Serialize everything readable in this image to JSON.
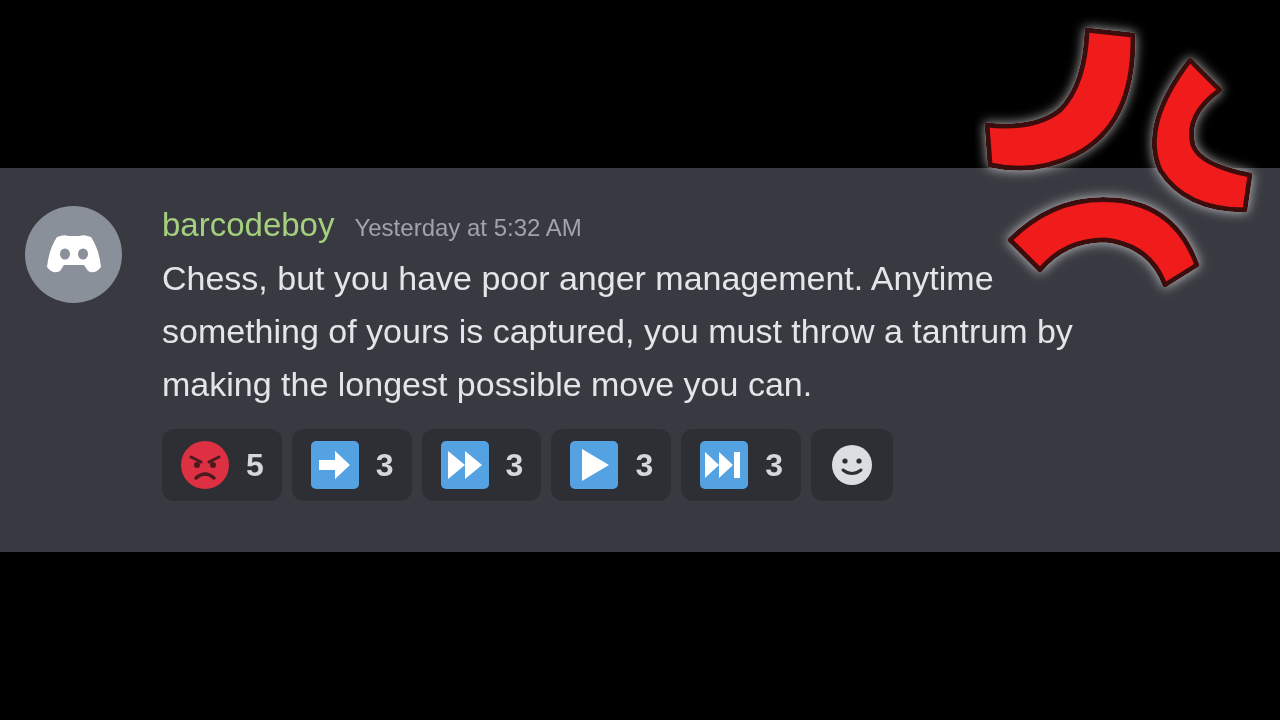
{
  "message": {
    "author": "barcodeboy",
    "timestamp": "Yesterday at 5:32 AM",
    "text": "Chess, but you have poor anger management. Anytime something of yours is captured, you must throw a tantrum by making the longest possible move you can."
  },
  "reactions": [
    {
      "kind": "angry",
      "count": "5"
    },
    {
      "kind": "arrow",
      "count": "3"
    },
    {
      "kind": "fast_forward",
      "count": "3"
    },
    {
      "kind": "play",
      "count": "3"
    },
    {
      "kind": "next_track",
      "count": "3"
    }
  ]
}
